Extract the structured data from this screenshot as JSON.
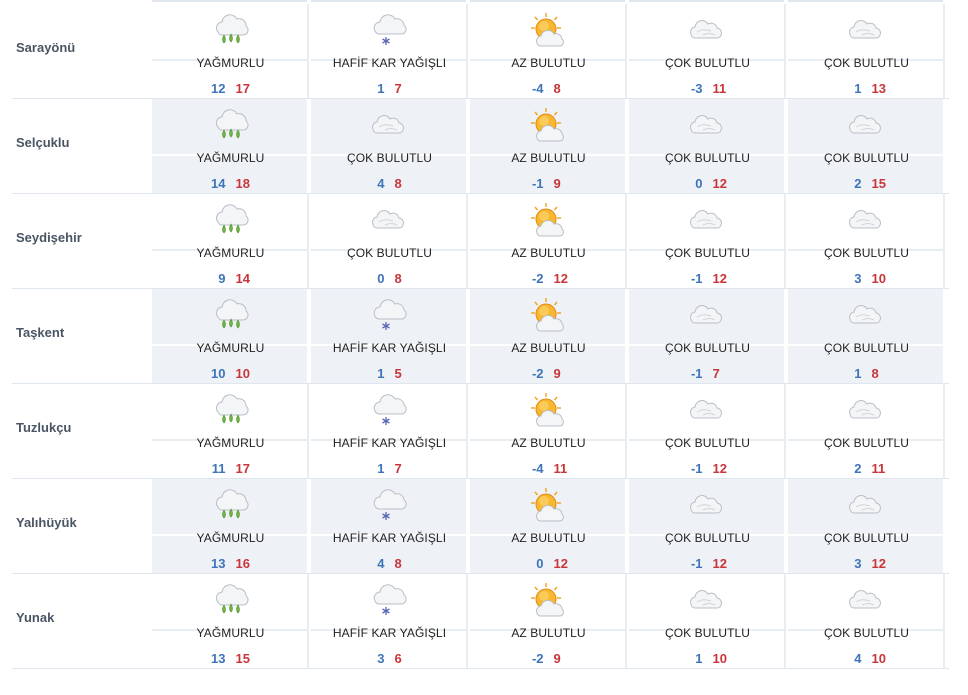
{
  "rows": [
    {
      "city": "Sarayönü",
      "days": [
        {
          "icon": "rain-icon",
          "desc": "YAĞMURLU",
          "min": "12",
          "max": "17"
        },
        {
          "icon": "light-snow-icon",
          "desc": "HAFİF KAR YAĞIŞLI",
          "min": "1",
          "max": "7"
        },
        {
          "icon": "partly-sunny-icon",
          "desc": "AZ BULUTLU",
          "min": "-4",
          "max": "8"
        },
        {
          "icon": "cloudy-icon",
          "desc": "ÇOK BULUTLU",
          "min": "-3",
          "max": "11"
        },
        {
          "icon": "cloudy-icon",
          "desc": "ÇOK BULUTLU",
          "min": "1",
          "max": "13"
        }
      ]
    },
    {
      "city": "Selçuklu",
      "days": [
        {
          "icon": "rain-icon",
          "desc": "YAĞMURLU",
          "min": "14",
          "max": "18"
        },
        {
          "icon": "cloudy-icon",
          "desc": "ÇOK BULUTLU",
          "min": "4",
          "max": "8"
        },
        {
          "icon": "partly-sunny-icon",
          "desc": "AZ BULUTLU",
          "min": "-1",
          "max": "9"
        },
        {
          "icon": "cloudy-icon",
          "desc": "ÇOK BULUTLU",
          "min": "0",
          "max": "12"
        },
        {
          "icon": "cloudy-icon",
          "desc": "ÇOK BULUTLU",
          "min": "2",
          "max": "15"
        }
      ]
    },
    {
      "city": "Seydişehir",
      "days": [
        {
          "icon": "rain-icon",
          "desc": "YAĞMURLU",
          "min": "9",
          "max": "14"
        },
        {
          "icon": "cloudy-icon",
          "desc": "ÇOK BULUTLU",
          "min": "0",
          "max": "8"
        },
        {
          "icon": "partly-sunny-icon",
          "desc": "AZ BULUTLU",
          "min": "-2",
          "max": "12"
        },
        {
          "icon": "cloudy-icon",
          "desc": "ÇOK BULUTLU",
          "min": "-1",
          "max": "12"
        },
        {
          "icon": "cloudy-icon",
          "desc": "ÇOK BULUTLU",
          "min": "3",
          "max": "10"
        }
      ]
    },
    {
      "city": "Taşkent",
      "days": [
        {
          "icon": "rain-icon",
          "desc": "YAĞMURLU",
          "min": "10",
          "max": "10"
        },
        {
          "icon": "light-snow-icon",
          "desc": "HAFİF KAR YAĞIŞLI",
          "min": "1",
          "max": "5"
        },
        {
          "icon": "partly-sunny-icon",
          "desc": "AZ BULUTLU",
          "min": "-2",
          "max": "9"
        },
        {
          "icon": "cloudy-icon",
          "desc": "ÇOK BULUTLU",
          "min": "-1",
          "max": "7"
        },
        {
          "icon": "cloudy-icon",
          "desc": "ÇOK BULUTLU",
          "min": "1",
          "max": "8"
        }
      ]
    },
    {
      "city": "Tuzlukçu",
      "days": [
        {
          "icon": "rain-icon",
          "desc": "YAĞMURLU",
          "min": "11",
          "max": "17"
        },
        {
          "icon": "light-snow-icon",
          "desc": "HAFİF KAR YAĞIŞLI",
          "min": "1",
          "max": "7"
        },
        {
          "icon": "partly-sunny-icon",
          "desc": "AZ BULUTLU",
          "min": "-4",
          "max": "11"
        },
        {
          "icon": "cloudy-icon",
          "desc": "ÇOK BULUTLU",
          "min": "-1",
          "max": "12"
        },
        {
          "icon": "cloudy-icon",
          "desc": "ÇOK BULUTLU",
          "min": "2",
          "max": "11"
        }
      ]
    },
    {
      "city": "Yalıhüyük",
      "days": [
        {
          "icon": "rain-icon",
          "desc": "YAĞMURLU",
          "min": "13",
          "max": "16"
        },
        {
          "icon": "light-snow-icon",
          "desc": "HAFİF KAR YAĞIŞLI",
          "min": "4",
          "max": "8"
        },
        {
          "icon": "partly-sunny-icon",
          "desc": "AZ BULUTLU",
          "min": "0",
          "max": "12"
        },
        {
          "icon": "cloudy-icon",
          "desc": "ÇOK BULUTLU",
          "min": "-1",
          "max": "12"
        },
        {
          "icon": "cloudy-icon",
          "desc": "ÇOK BULUTLU",
          "min": "3",
          "max": "12"
        }
      ]
    },
    {
      "city": "Yunak",
      "days": [
        {
          "icon": "rain-icon",
          "desc": "YAĞMURLU",
          "min": "13",
          "max": "15"
        },
        {
          "icon": "light-snow-icon",
          "desc": "HAFİF KAR YAĞIŞLI",
          "min": "3",
          "max": "6"
        },
        {
          "icon": "partly-sunny-icon",
          "desc": "AZ BULUTLU",
          "min": "-2",
          "max": "9"
        },
        {
          "icon": "cloudy-icon",
          "desc": "ÇOK BULUTLU",
          "min": "1",
          "max": "10"
        },
        {
          "icon": "cloudy-icon",
          "desc": "ÇOK BULUTLU",
          "min": "4",
          "max": "10"
        }
      ]
    }
  ],
  "colors": {
    "min": "#3e74b9",
    "max": "#c8353b",
    "alt_row": "#eef2f6"
  }
}
